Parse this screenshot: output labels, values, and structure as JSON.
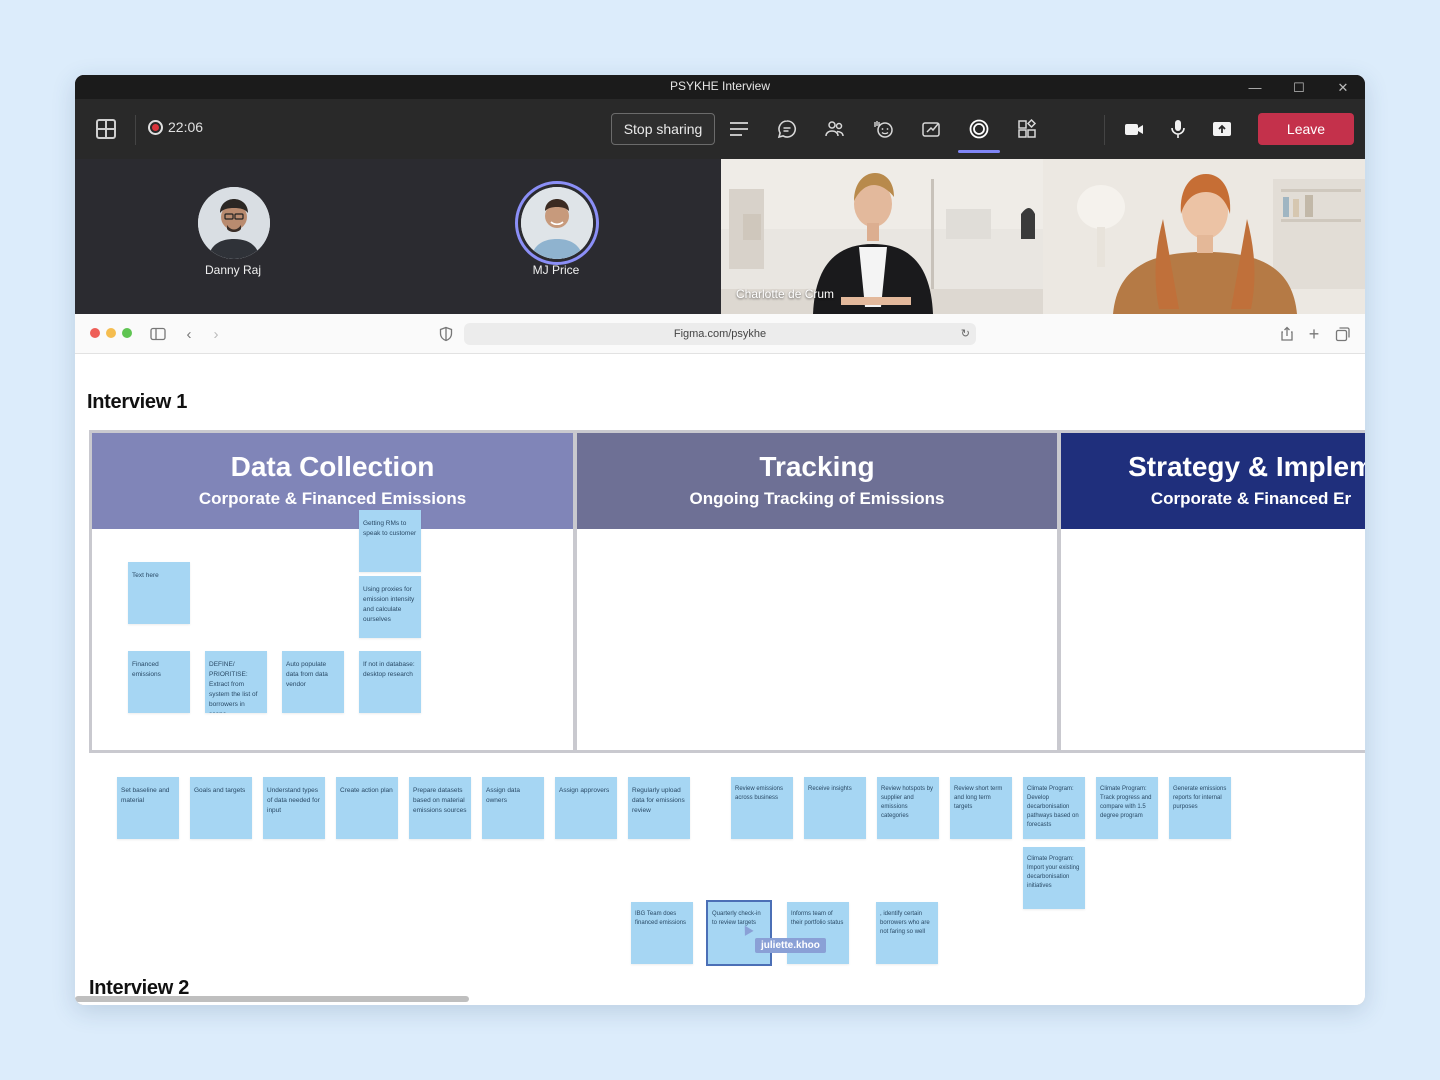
{
  "window": {
    "title": "PSYKHE Interview"
  },
  "toolbar": {
    "timer": "22:06",
    "stop_sharing": "Stop sharing",
    "leave": "Leave",
    "icons": [
      "list-icon",
      "chat-icon",
      "people-icon",
      "reactions-icon",
      "whiteboard-icon",
      "focus-icon",
      "apps-icon",
      "camera-icon",
      "mic-icon",
      "share-icon"
    ]
  },
  "participants": {
    "p1": "Danny Raj",
    "p2": "MJ Price",
    "p3": "Charlotte de Crum"
  },
  "browser": {
    "url": "Figma.com/psykhe"
  },
  "board": {
    "heading1": "Interview 1",
    "heading2": "Interview 2",
    "columns": [
      {
        "title": "Data Collection",
        "subtitle": "Corporate & Financed Emissions",
        "color": "#8085b8"
      },
      {
        "title": "Tracking",
        "subtitle": "Ongoing Tracking of Emissions",
        "color": "#6e7095"
      },
      {
        "title": "Strategy & Implem",
        "subtitle": "Corporate & Financed Er",
        "color": "#1f2f7c"
      }
    ],
    "inside": {
      "n1": "Getting RMs to speak to customer",
      "n2": "Text here",
      "n3": "Using proxies for emission intensity and calculate ourselves",
      "n4": "Financed emissions",
      "n5": "DEFINE/ PRIORITISE: Extract from system the list of borrowers in scope",
      "n6": "Auto populate data from data vendor",
      "n7": "If not in database: desktop research"
    },
    "row": {
      "r1": "Set baseline and material",
      "r2": "Goals and targets",
      "r3": "Understand types of data needed for input",
      "r4": "Create action plan",
      "r5": "Prepare datasets based on material emissions sources",
      "r6": "Assign data owners",
      "r7": "Assign approvers",
      "r8": "Regularly upload data for emissions review",
      "r9": "Review emissions across business",
      "r10": "Receive insights",
      "r11": "Review hotspots by supplier and emissions categories",
      "r12": "Review short term and long term targets",
      "r13": "Climate Program: Develop decarbonisation pathways based on forecasts",
      "r14": "Climate Program: Track progress and compare with 1.5 degree program",
      "r15": "Generate emissions reports for internal purposes",
      "r16": "Climate Program: Import your existing decarbonisation initiatives"
    },
    "lower": {
      "l1": "IBG Team does financed emissions",
      "l2": "Quarterly check-in to review targets",
      "l3": "Informs team of their portfolio status",
      "l4": ", identify certain borrowers who are not faring so well"
    },
    "cursor_user": "juliette.khoo"
  }
}
